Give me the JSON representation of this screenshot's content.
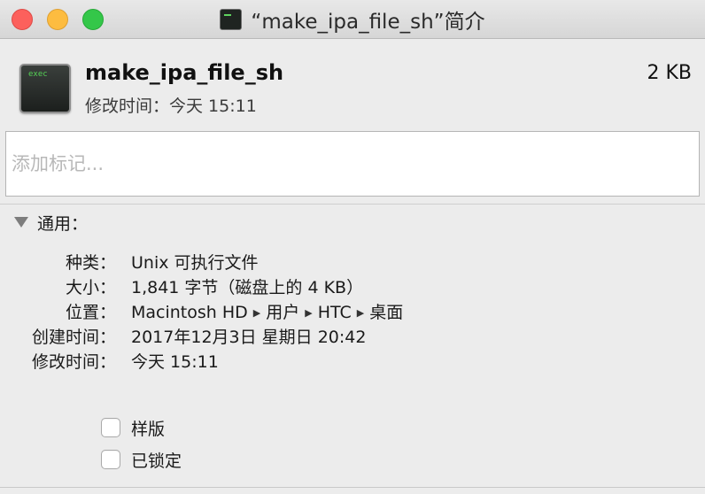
{
  "window": {
    "title": "“make_ipa_file_sh”简介"
  },
  "file": {
    "icon_label": "exec",
    "name": "make_ipa_file_sh",
    "size": "2 KB",
    "modified_line": "修改时间：今天 15:11"
  },
  "tags": {
    "placeholder": "添加标记..."
  },
  "general": {
    "section_title": "通用：",
    "kind": {
      "label": "种类：",
      "value": "Unix 可执行文件"
    },
    "size": {
      "label": "大小：",
      "value": "1,841 字节（磁盘上的 4 KB）"
    },
    "where": {
      "label": "位置：",
      "path": [
        "Macintosh HD",
        "用户",
        "HTC",
        "桌面"
      ]
    },
    "created": {
      "label": "创建时间：",
      "value": "2017年12月3日 星期日 20:42"
    },
    "modified": {
      "label": "修改时间：",
      "value": "今天 15:11"
    },
    "stationery": {
      "label": "样版",
      "checked": false
    },
    "locked": {
      "label": "已锁定",
      "checked": false
    }
  },
  "colors": {
    "close": "#fc605c",
    "minimize": "#fdbc40",
    "zoom": "#34c749",
    "terminal_green": "#55d155"
  },
  "icons": {
    "title_icon": "terminal-icon",
    "file_icon": "exec-icon",
    "disclosure": "disclosure-triangle-icon",
    "path_separator": "path-arrow-icon"
  }
}
